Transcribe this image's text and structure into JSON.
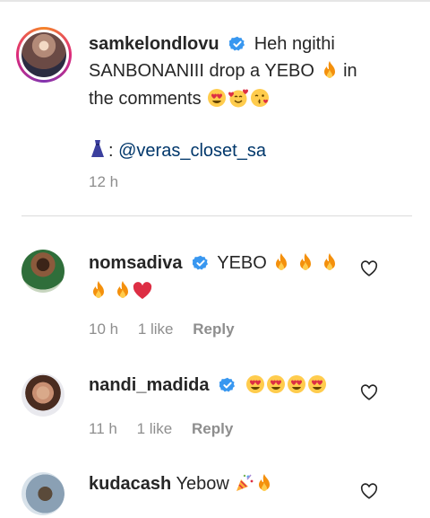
{
  "caption": {
    "username": "samkelondlovu",
    "text_line": "Heh ngithi SANBONANIII drop a YEBO",
    "text_tail": "in the comments",
    "mention_prefix": ":",
    "mention": "@veras_closet_sa",
    "time": "12 h"
  },
  "comments": [
    {
      "username": "nomsadiva",
      "text": "YEBO",
      "time": "10 h",
      "likes": "1 like",
      "reply": "Reply"
    },
    {
      "username": "nandi_madida",
      "text": "",
      "time": "11 h",
      "likes": "1 like",
      "reply": "Reply"
    },
    {
      "username": "kudacash",
      "text": "Yebow"
    }
  ],
  "icons": {
    "verified_color": "#3897f0",
    "fire": "fire-emoji",
    "heart_eyes": "heart-eyes-emoji",
    "smiling_hearts": "smiling-face-with-hearts-emoji",
    "kiss": "face-blowing-kiss-emoji",
    "red_heart": "red-heart-emoji",
    "party": "party-popper-emoji",
    "dress": "dress-emoji",
    "like": "heart-outline-icon"
  }
}
